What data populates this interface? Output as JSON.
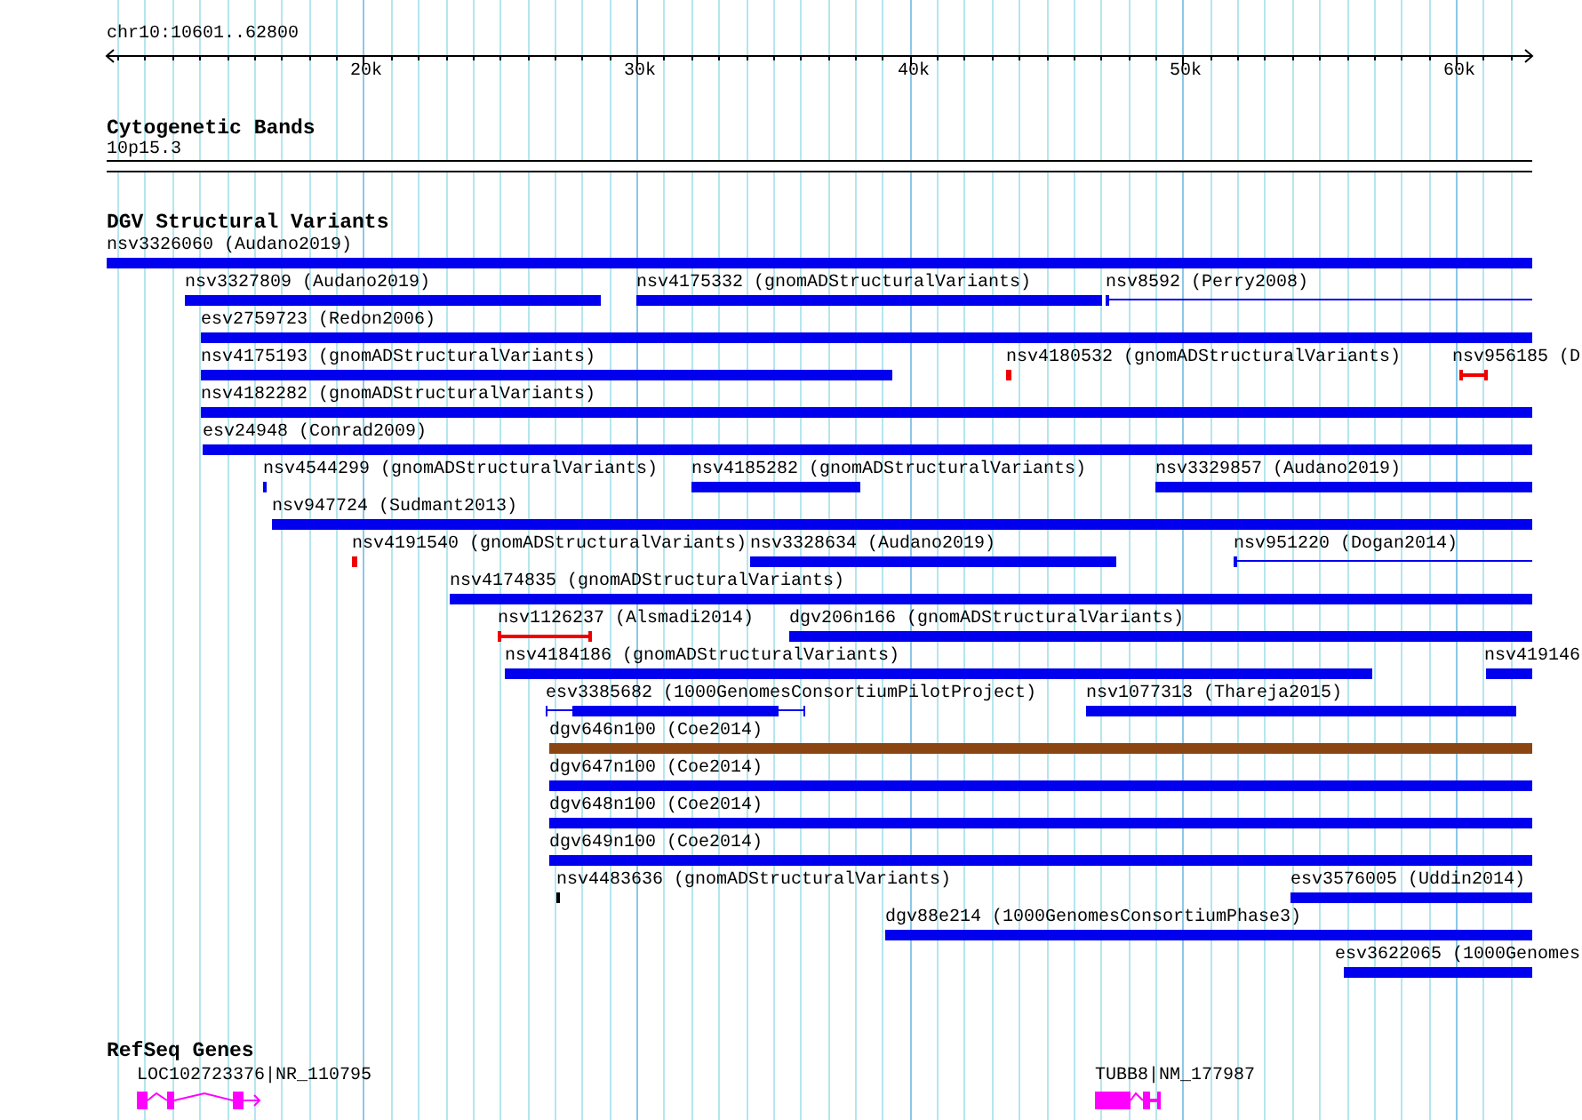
{
  "location": "chr10:10601..62800",
  "ruler": {
    "ticks": [
      "20k",
      "30k",
      "40k",
      "50k",
      "60k"
    ]
  },
  "cytogenetic_bands": {
    "title": "Cytogenetic Bands",
    "bands": [
      {
        "name": "10p15.3"
      }
    ]
  },
  "dgv": {
    "title": "DGV Structural Variants",
    "rows": [
      [
        {
          "label": "nsv3326060 (Audano2019)",
          "kind": "block",
          "color": "#0000ee"
        }
      ],
      [
        {
          "label": "nsv3327809 (Audano2019)",
          "kind": "block",
          "color": "#0000ee"
        },
        {
          "label": "nsv4175332 (gnomADStructuralVariants)",
          "kind": "block",
          "color": "#0000ee"
        },
        {
          "label": "nsv8592 (Perry2008)",
          "kind": "line",
          "color": "#0000ee"
        }
      ],
      [
        {
          "label": "esv2759723 (Redon2006)",
          "kind": "block",
          "color": "#0000ee"
        }
      ],
      [
        {
          "label": "nsv4175193 (gnomADStructuralVariants)",
          "kind": "block",
          "color": "#0000ee"
        },
        {
          "label": "nsv4180532 (gnomADStructuralVariants)",
          "kind": "block",
          "color": "#ee0000"
        },
        {
          "label": "nsv956185 (D",
          "kind": "whisker",
          "color": "#ee0000"
        }
      ],
      [
        {
          "label": "nsv4182282 (gnomADStructuralVariants)",
          "kind": "block",
          "color": "#0000ee"
        }
      ],
      [
        {
          "label": "esv24948 (Conrad2009)",
          "kind": "block",
          "color": "#0000ee"
        }
      ],
      [
        {
          "label": "nsv4544299 (gnomADStructuralVariants)",
          "kind": "block",
          "color": "#0000ee"
        },
        {
          "label": "nsv4185282 (gnomADStructuralVariants)",
          "kind": "block",
          "color": "#0000ee"
        },
        {
          "label": "nsv3329857 (Audano2019)",
          "kind": "block",
          "color": "#0000ee"
        }
      ],
      [
        {
          "label": "nsv947724 (Sudmant2013)",
          "kind": "block",
          "color": "#0000ee"
        }
      ],
      [
        {
          "label": "nsv4191540 (gnomADStructuralVariants)",
          "kind": "block",
          "color": "#ee0000"
        },
        {
          "label": "nsv3328634 (Audano2019)",
          "kind": "block",
          "color": "#0000ee"
        },
        {
          "label": "nsv951220 (Dogan2014)",
          "kind": "line",
          "color": "#0000ee"
        }
      ],
      [
        {
          "label": "nsv4174835 (gnomADStructuralVariants)",
          "kind": "block",
          "color": "#0000ee"
        }
      ],
      [
        {
          "label": "nsv1126237 (Alsmadi2014)",
          "kind": "whisker",
          "color": "#ee0000"
        },
        {
          "label": "dgv206n166 (gnomADStructuralVariants)",
          "kind": "block",
          "color": "#0000ee"
        }
      ],
      [
        {
          "label": "nsv4184186 (gnomADStructuralVariants)",
          "kind": "block",
          "color": "#0000ee"
        },
        {
          "label": "nsv419146",
          "kind": "block",
          "color": "#0000ee"
        }
      ],
      [
        {
          "label": "esv3385682 (1000GenomesConsortiumPilotProject)",
          "kind": "thick",
          "color": "#0000ee"
        },
        {
          "label": "nsv1077313 (Thareja2015)",
          "kind": "block",
          "color": "#0000ee"
        }
      ],
      [
        {
          "label": "dgv646n100 (Coe2014)",
          "kind": "block",
          "color": "#8b4513"
        }
      ],
      [
        {
          "label": "dgv647n100 (Coe2014)",
          "kind": "block",
          "color": "#0000ee"
        }
      ],
      [
        {
          "label": "dgv648n100 (Coe2014)",
          "kind": "block",
          "color": "#0000ee"
        }
      ],
      [
        {
          "label": "dgv649n100 (Coe2014)",
          "kind": "block",
          "color": "#0000ee"
        }
      ],
      [
        {
          "label": "nsv4483636 (gnomADStructuralVariants)",
          "kind": "block",
          "color": "#000000"
        },
        {
          "label": "esv3576005 (Uddin2014)",
          "kind": "block",
          "color": "#0000ee"
        }
      ],
      [
        {
          "label": "dgv88e214 (1000GenomesConsortiumPhase3)",
          "kind": "block",
          "color": "#0000ee"
        }
      ],
      [
        {
          "label": "esv3622065 (1000Genomes",
          "kind": "block",
          "color": "#0000ee"
        }
      ]
    ]
  },
  "refseq": {
    "title": "RefSeq Genes",
    "genes": [
      {
        "label": "LOC102723376|NR_110795"
      },
      {
        "label": "TUBB8|NM_177987"
      }
    ]
  }
}
